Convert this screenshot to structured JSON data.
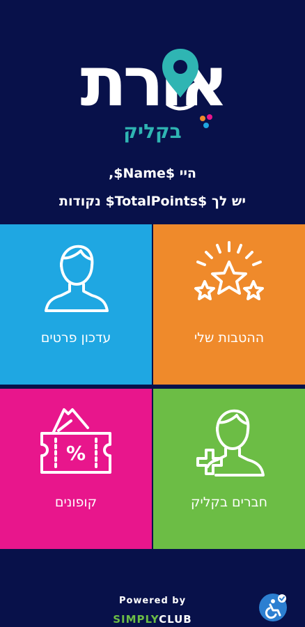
{
  "logo": {
    "name": "אורת",
    "sub": "בקליק",
    "colors": {
      "pin": "#2fb5b3",
      "dot1": "#ef8a2b",
      "dot2": "#e8168c",
      "dot3": "#1fa7e2"
    }
  },
  "greeting": {
    "line1": "היי $Name$,",
    "line2": "יש לך $TotalPoints$ נקודות"
  },
  "tiles": [
    {
      "label": "עדכון פרטים",
      "icon": "user-icon",
      "color": "#1fa7e2"
    },
    {
      "label": "ההטבות שלי",
      "icon": "stars-icon",
      "color": "#ef8a2b"
    },
    {
      "label": "קופונים",
      "icon": "coupon-icon",
      "color": "#e8168c"
    },
    {
      "label": "חברים בקליק",
      "icon": "add-user-icon",
      "color": "#6cbd45"
    }
  ],
  "footer": {
    "powered": "Powered by",
    "brand_part1": "SIMPLY",
    "brand_part2": "CLUB"
  },
  "accessibility": {
    "icon": "accessibility-icon"
  }
}
